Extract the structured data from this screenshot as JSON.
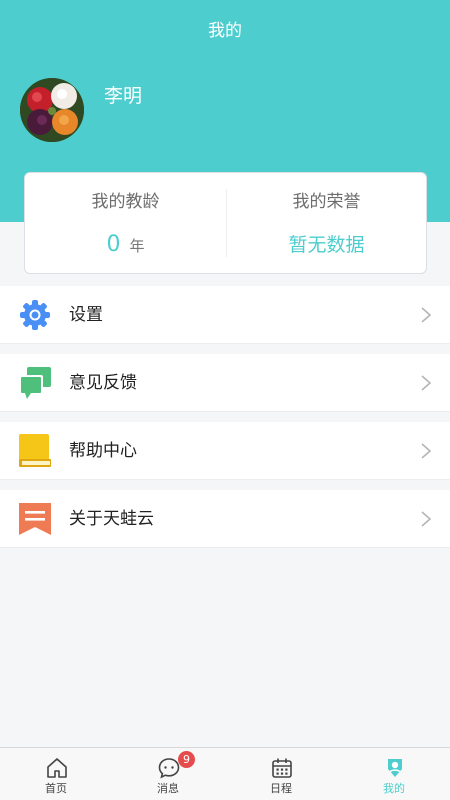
{
  "header": {
    "title": "我的"
  },
  "profile": {
    "name": "李明"
  },
  "stats": {
    "teaching_years": {
      "label": "我的教龄",
      "value": "0",
      "unit": "年"
    },
    "honors": {
      "label": "我的荣誉",
      "value": "暂无数据"
    }
  },
  "menu": [
    {
      "label": "设置",
      "icon": "gear-icon",
      "color": "#4a8ff5"
    },
    {
      "label": "意见反馈",
      "icon": "chat-bubble-icon",
      "color": "#4ec07c"
    },
    {
      "label": "帮助中心",
      "icon": "book-icon",
      "color": "#f5c518"
    },
    {
      "label": "关于天蛙云",
      "icon": "bookmark-icon",
      "color": "#ef7b55"
    }
  ],
  "tabbar": {
    "items": [
      {
        "label": "首页",
        "icon": "home-icon"
      },
      {
        "label": "消息",
        "icon": "message-icon",
        "badge": "9"
      },
      {
        "label": "日程",
        "icon": "calendar-icon"
      },
      {
        "label": "我的",
        "icon": "profile-icon"
      }
    ],
    "active_index": 3
  },
  "colors": {
    "accent": "#4ecdce",
    "badge": "#e74c4c"
  }
}
